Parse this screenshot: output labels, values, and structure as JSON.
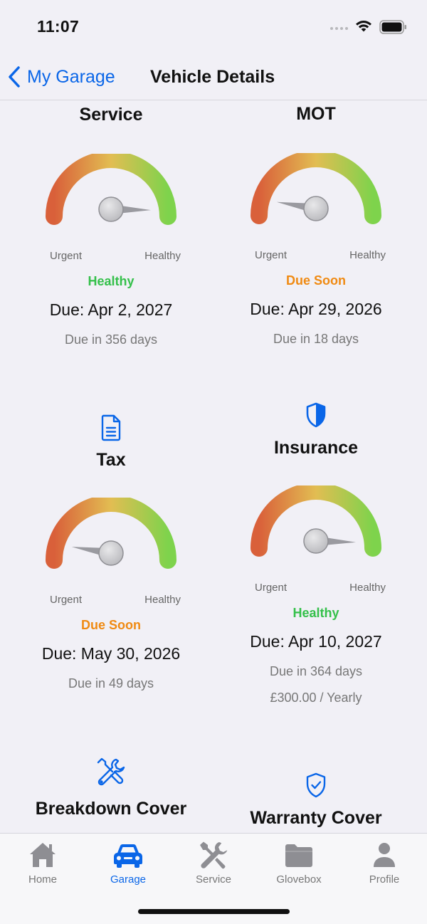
{
  "status_bar": {
    "time": "11:07"
  },
  "nav": {
    "back_label": "My Garage",
    "title": "Vehicle Details"
  },
  "gauge_labels": {
    "urgent": "Urgent",
    "healthy": "Healthy"
  },
  "cards": [
    {
      "title": "Service",
      "status": "Healthy",
      "due": "Due: Apr 2, 2027",
      "days": "Due in 356 days",
      "health": 0.92
    },
    {
      "title": "MOT",
      "status": "Due Soon",
      "due": "Due: Apr 29, 2026",
      "days": "Due in 18 days",
      "health": 0.05
    },
    {
      "title": "Tax",
      "icon": "document-icon",
      "status": "Due Soon",
      "due": "Due: May 30, 2026",
      "days": "Due in 49 days",
      "health": 0.12
    },
    {
      "title": "Insurance",
      "icon": "shield-icon",
      "status": "Healthy",
      "due": "Due: Apr 10, 2027",
      "days": "Due in 364 days",
      "cost": "£300.00 / Yearly",
      "health": 0.95
    },
    {
      "title": "Breakdown Cover",
      "icon": "tools-icon"
    },
    {
      "title": "Warranty Cover",
      "icon": "shield-check-icon"
    }
  ],
  "tabs": [
    {
      "label": "Home",
      "icon": "house-icon"
    },
    {
      "label": "Garage",
      "icon": "car-icon",
      "active": true
    },
    {
      "label": "Service",
      "icon": "tools-icon"
    },
    {
      "label": "Glovebox",
      "icon": "folder-icon"
    },
    {
      "label": "Profile",
      "icon": "person-icon"
    }
  ],
  "colors": {
    "accent": "#0a66e8",
    "healthy": "#34c04a",
    "due_soon": "#f08a12",
    "gauge_start": "#d9603a",
    "gauge_mid": "#e2bd52",
    "gauge_end": "#7ed34c"
  }
}
